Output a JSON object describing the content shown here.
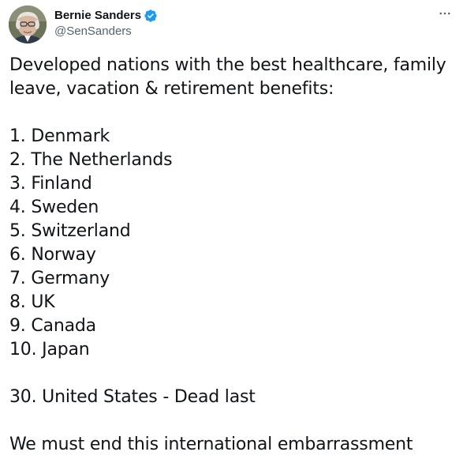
{
  "author": {
    "display_name": "Bernie Sanders",
    "handle": "@SenSanders",
    "verified": true,
    "verified_color": "#1d9bf0"
  },
  "menu": {
    "icon": "more-horizontal-icon"
  },
  "tweet": {
    "intro": "Developed nations with the best healthcare, family leave, vacation & retirement benefits:",
    "ranking": [
      "1. Denmark",
      "2. The Netherlands",
      "3. Finland",
      "4. Sweden",
      "5. Switzerland",
      "6. Norway",
      "7. Germany",
      "8. UK",
      "9. Canada",
      "10. Japan"
    ],
    "us_line": "30. United States - Dead last",
    "closing": "We must end this international embarrassment"
  }
}
